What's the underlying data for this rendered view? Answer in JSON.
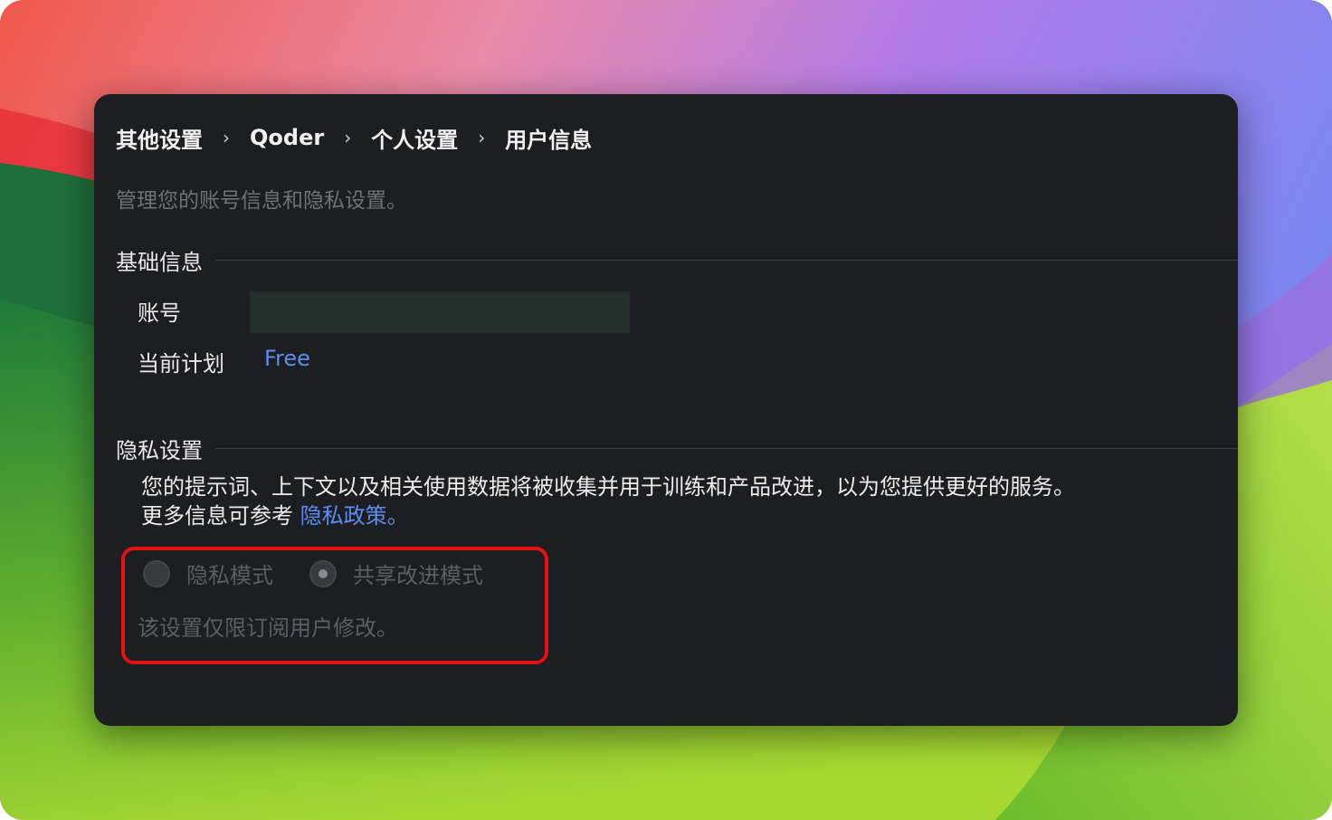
{
  "breadcrumb": {
    "items": [
      "其他设置",
      "Qoder",
      "个人设置",
      "用户信息"
    ],
    "separator": "›"
  },
  "subtitle": "管理您的账号信息和隐私设置。",
  "basic_info": {
    "heading": "基础信息",
    "account_label": "账号",
    "plan_label": "当前计划",
    "plan_value": "Free"
  },
  "privacy": {
    "heading": "隐私设置",
    "description_line1": "您的提示词、上下文以及相关使用数据将被收集并用于训练和产品改进，以为您提供更好的服务。",
    "description_line2_prefix": "更多信息可参考 ",
    "policy_link": "隐私政策",
    "description_line2_suffix": "。",
    "options": [
      {
        "label": "隐私模式",
        "selected": false,
        "disabled": true
      },
      {
        "label": "共享改进模式",
        "selected": true,
        "disabled": true
      }
    ],
    "restriction_note": "该设置仅限订阅用户修改。"
  },
  "colors": {
    "panel_bg": "#1d1e21",
    "link": "#5b8ef0",
    "highlight_border": "#e31111",
    "muted_text": "#6f7176"
  }
}
